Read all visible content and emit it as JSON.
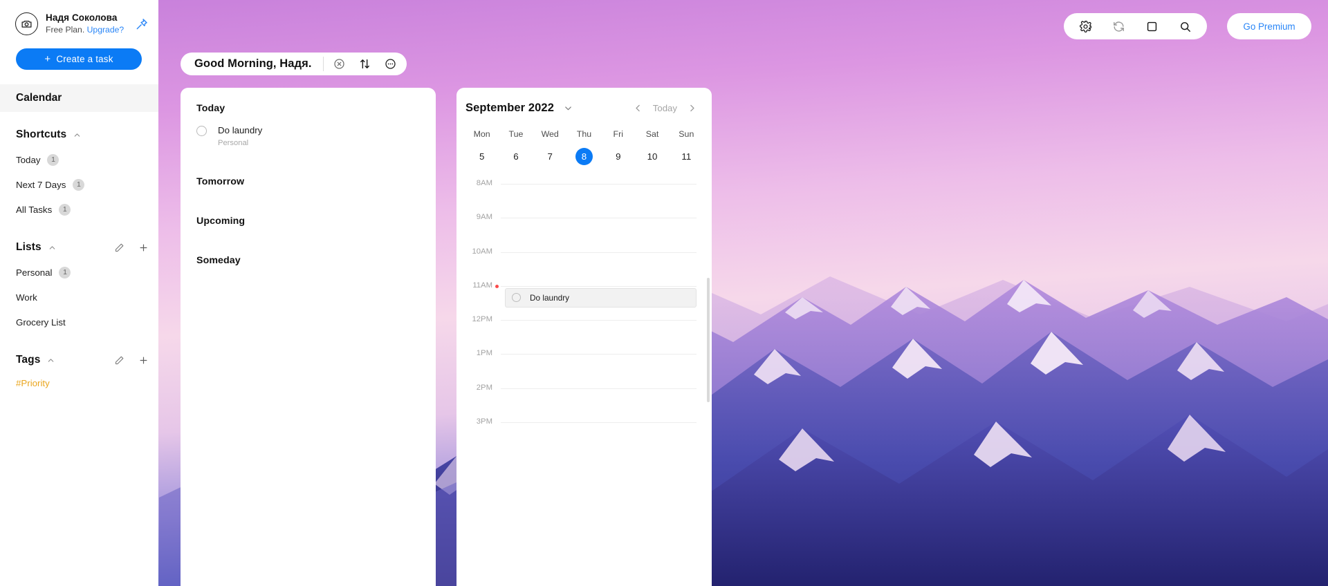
{
  "sidebar": {
    "account": {
      "name": "Надя Соколова",
      "plan_text": "Free Plan.",
      "upgrade_text": "Upgrade?"
    },
    "create_task_label": "Create a task",
    "create_task_plus": "+",
    "calendar_label": "Calendar",
    "shortcuts": {
      "title": "Shortcuts",
      "items": [
        {
          "label": "Today",
          "count": "1"
        },
        {
          "label": "Next 7 Days",
          "count": "1"
        },
        {
          "label": "All Tasks",
          "count": "1"
        }
      ]
    },
    "lists": {
      "title": "Lists",
      "items": [
        {
          "label": "Personal",
          "count": "1"
        },
        {
          "label": "Work",
          "count": ""
        },
        {
          "label": "Grocery List",
          "count": ""
        }
      ]
    },
    "tags": {
      "title": "Tags",
      "items": [
        {
          "label": "#Priority"
        }
      ]
    }
  },
  "toolbar": {
    "icons": [
      "gear-icon",
      "sync-icon",
      "fullscreen-icon",
      "search-icon"
    ],
    "premium_label": "Go Premium"
  },
  "greeting": {
    "text": "Good Morning, Надя.",
    "icons": [
      "hide-completed-icon",
      "sort-icon",
      "more-options-icon"
    ]
  },
  "tasks": {
    "groups": [
      {
        "title": "Today",
        "items": [
          {
            "title": "Do laundry",
            "list": "Personal"
          }
        ]
      },
      {
        "title": "Tomorrow",
        "items": []
      },
      {
        "title": "Upcoming",
        "items": []
      },
      {
        "title": "Someday",
        "items": []
      }
    ]
  },
  "calendar": {
    "month_label": "September 2022",
    "today_label": "Today",
    "weekdays": [
      "Mon",
      "Tue",
      "Wed",
      "Thu",
      "Fri",
      "Sat",
      "Sun"
    ],
    "days": [
      {
        "num": "5",
        "selected": false
      },
      {
        "num": "6",
        "selected": false
      },
      {
        "num": "7",
        "selected": false
      },
      {
        "num": "8",
        "selected": true
      },
      {
        "num": "9",
        "selected": false
      },
      {
        "num": "10",
        "selected": false
      },
      {
        "num": "11",
        "selected": false
      }
    ],
    "time_slots": [
      "8AM",
      "9AM",
      "10AM",
      "11AM",
      "12PM",
      "1PM",
      "2PM",
      "3PM"
    ],
    "events": [
      {
        "title": "Do laundry",
        "slot": "11AM"
      }
    ]
  },
  "colors": {
    "accent_blue": "#0b7bf5",
    "link_blue": "#2a86f7",
    "tag_orange": "#eaa61e",
    "now_marker_red": "#fb4b4b",
    "badge_gray": "#d8d8d8"
  }
}
